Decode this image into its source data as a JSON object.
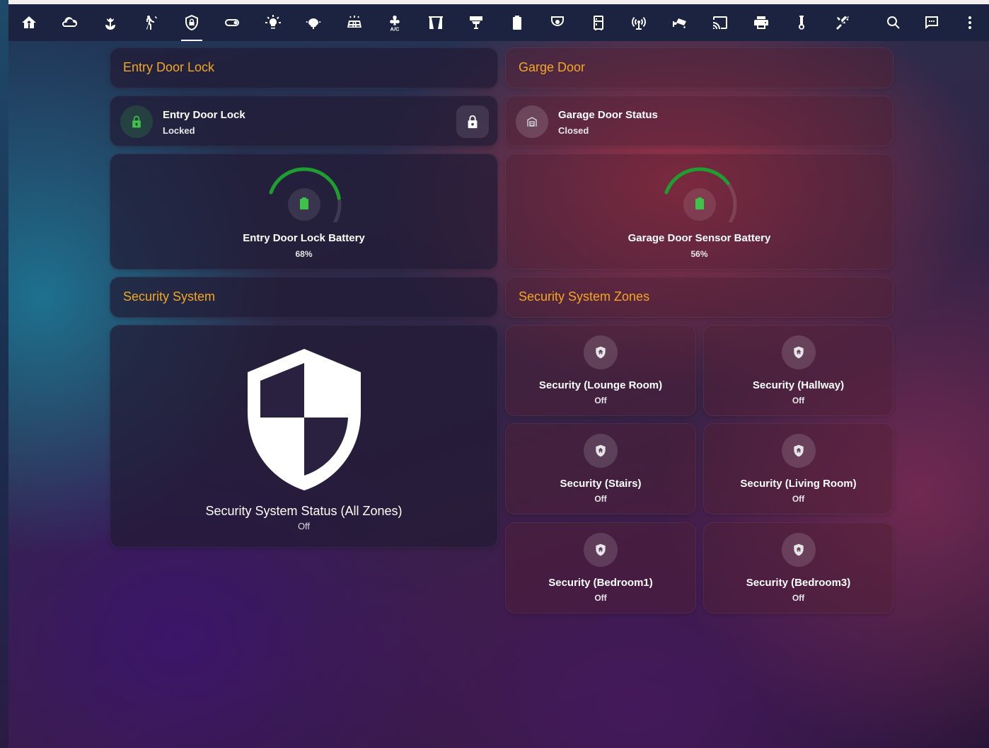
{
  "toolbar": {
    "icons": [
      "home-account-icon",
      "weather-cloud-icon",
      "flower-icon",
      "motion-sensor-icon",
      "shield-lock-icon",
      "toggle-switch-icon",
      "lightbulb-icon",
      "ceiling-light-icon",
      "solar-panel-icon",
      "air-conditioner-icon",
      "curtains-icon",
      "lamp-icon",
      "battery-icon",
      "cctv-icon",
      "fridge-icon",
      "wifi-router-icon",
      "security-camera-icon",
      "cast-icon",
      "printer-icon",
      "thermometer-icon",
      "tools-icon"
    ],
    "active_index": 4,
    "right_icons": [
      "search-icon",
      "chat-icon",
      "more-vertical-icon"
    ]
  },
  "entry_door": {
    "header": "Entry Door Lock",
    "lock_name": "Entry Door Lock",
    "lock_state": "Locked",
    "battery_label": "Entry Door Lock Battery",
    "battery_value": "68%",
    "battery_fraction": 0.68
  },
  "garage": {
    "header": "Garge Door",
    "status_name": "Garage Door Status",
    "status_state": "Closed",
    "battery_label": "Garage Door Sensor Battery",
    "battery_value": "56%",
    "battery_fraction": 0.56
  },
  "security": {
    "header": "Security System",
    "status_name": "Security System Status (All Zones)",
    "status_state": "Off"
  },
  "zones": {
    "header": "Security System Zones",
    "items": [
      {
        "name": "Security (Lounge Room)",
        "state": "Off"
      },
      {
        "name": "Security (Hallway)",
        "state": "Off"
      },
      {
        "name": "Security (Stairs)",
        "state": "Off"
      },
      {
        "name": "Security (Living Room)",
        "state": "Off"
      },
      {
        "name": "Security (Bedroom1)",
        "state": "Off"
      },
      {
        "name": "Security (Bedroom3)",
        "state": "Off"
      }
    ]
  },
  "colors": {
    "accent_header": "#f5a623",
    "gauge_green": "#1e9e2f",
    "lock_green": "#3ec24a"
  }
}
